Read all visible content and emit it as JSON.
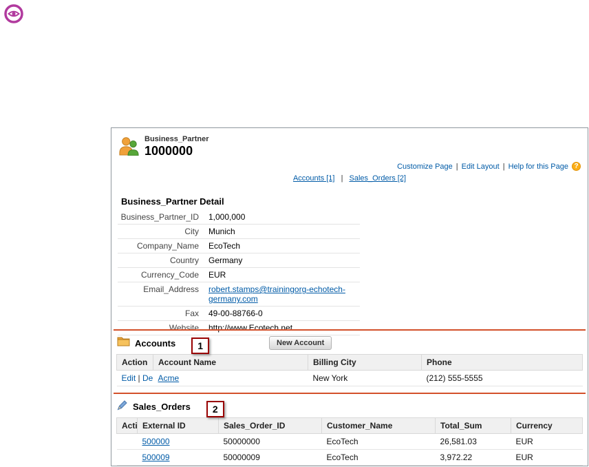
{
  "ui": {
    "separator": "|"
  },
  "icons": {
    "eye": "eye-icon",
    "record": "business-partner-people-icon",
    "help": "help-icon",
    "accounts": "folder-icon",
    "sales_orders": "pen-icon"
  },
  "colors": {
    "annotation_orange": "#d3502a",
    "annotation_red": "#990000",
    "link_blue": "#015ba7",
    "help_orange": "#fcaf17",
    "eye_magenta": "#b13a9e"
  },
  "header": {
    "object_label": "Business_Partner",
    "record_name": "1000000",
    "actions": [
      "Customize Page",
      "Edit Layout",
      "Help for this Page"
    ],
    "shortcuts": [
      "Accounts [1]",
      "Sales_Orders [2]"
    ]
  },
  "detail": {
    "title": "Business_Partner Detail",
    "fields": [
      {
        "label": "Business_Partner_ID",
        "value": "1,000,000"
      },
      {
        "label": "City",
        "value": "Munich"
      },
      {
        "label": "Company_Name",
        "value": "EcoTech"
      },
      {
        "label": "Country",
        "value": "Germany"
      },
      {
        "label": "Currency_Code",
        "value": "EUR"
      },
      {
        "label": "Email_Address",
        "value": "robert.stamps@trainingorg-echotech-germany.com"
      },
      {
        "label": "Fax",
        "value": "49-00-88766-0"
      },
      {
        "label": "Website",
        "value": "http://www.Ecotech.net"
      }
    ]
  },
  "accounts": {
    "title": "Accounts",
    "annotation_number": "1",
    "new_button": "New Account",
    "columns": [
      "Action",
      "Account Name",
      "Billing City",
      "Phone"
    ],
    "row_actions": {
      "edit": "Edit",
      "del": "Del"
    },
    "rows": [
      {
        "account_name": "Acme",
        "billing_city": "New York",
        "phone": "(212) 555-5555"
      }
    ]
  },
  "sales_orders": {
    "title": "Sales_Orders",
    "annotation_number": "2",
    "columns": [
      "Action",
      "External ID",
      "Sales_Order_ID",
      "Customer_Name",
      "Total_Sum",
      "Currency"
    ],
    "rows": [
      {
        "external_id": "500000",
        "sales_order_id": "50000000",
        "customer_name": "EcoTech",
        "total_sum": "26,581.03",
        "currency": "EUR"
      },
      {
        "external_id": "500009",
        "sales_order_id": "50000009",
        "customer_name": "EcoTech",
        "total_sum": "3,972.22",
        "currency": "EUR"
      }
    ]
  }
}
